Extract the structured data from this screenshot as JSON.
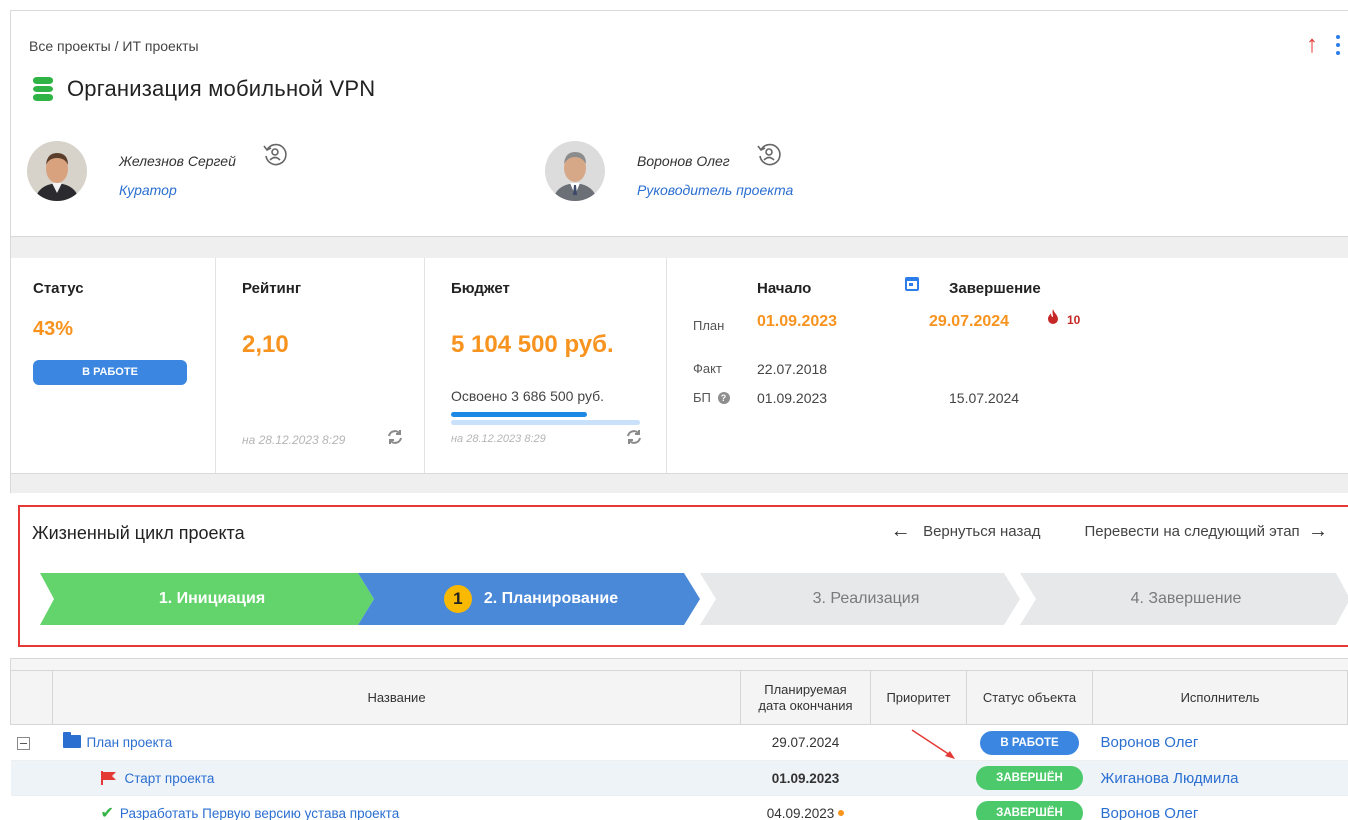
{
  "breadcrumb": "Все проекты / ИТ проекты",
  "project_title": "Организация мобильной VPN",
  "people": [
    {
      "name": "Железнов Сергей",
      "role": "Куратор"
    },
    {
      "name": "Воронов Олег",
      "role": "Руководитель проекта"
    }
  ],
  "status": {
    "label": "Статус",
    "percent": "43%",
    "badge": "В РАБОТЕ"
  },
  "rating": {
    "label": "Рейтинг",
    "value": "2,10",
    "asof": "на 28.12.2023 8:29"
  },
  "budget": {
    "label": "Бюджет",
    "value": "5 104 500 руб.",
    "mastered": "Освоено  3 686 500 руб.",
    "mastered_fraction": 0.722,
    "asof": "на 28.12.2023 8:29"
  },
  "dates": {
    "start_label": "Начало",
    "end_label": "Завершение",
    "plan_label": "План",
    "fact_label": "Факт",
    "bp_label": "БП",
    "plan_start": "01.09.2023",
    "plan_end": "29.07.2024",
    "overdue": "10",
    "fact_start": "22.07.2018",
    "bp_start": "01.09.2023",
    "bp_end": "15.07.2024"
  },
  "lifecycle": {
    "title": "Жизненный цикл проекта",
    "back": "Вернуться назад",
    "next": "Перевести на следующий этап",
    "stages": [
      {
        "label": "1. Инициация",
        "state": "done"
      },
      {
        "label": "2. Планирование",
        "state": "current",
        "marker": "1"
      },
      {
        "label": "3. Реализация",
        "state": "pending"
      },
      {
        "label": "4. Завершение",
        "state": "pending"
      }
    ]
  },
  "table": {
    "headers": {
      "name": "Название",
      "due_line1": "Планируемая",
      "due_line2": "дата окончания",
      "priority": "Приоритет",
      "status": "Статус объекта",
      "owner": "Исполнитель"
    },
    "rows": [
      {
        "name": "План проекта",
        "due": "29.07.2024",
        "status": "В РАБОТЕ",
        "owner": "Воронов Олег"
      },
      {
        "name": "Старт проекта",
        "due": "01.09.2023",
        "status": "ЗАВЕРШЁН",
        "owner": "Жиганова Людмила"
      },
      {
        "name": "Разработать Первую версию устава проекта",
        "due": "04.09.2023",
        "status": "ЗАВЕРШЁН",
        "owner": "Воронов Олег"
      }
    ]
  },
  "colors": {
    "accent": "#2b7de9",
    "orange": "#f7931e",
    "green": "#2fb344",
    "red": "#e53935"
  }
}
